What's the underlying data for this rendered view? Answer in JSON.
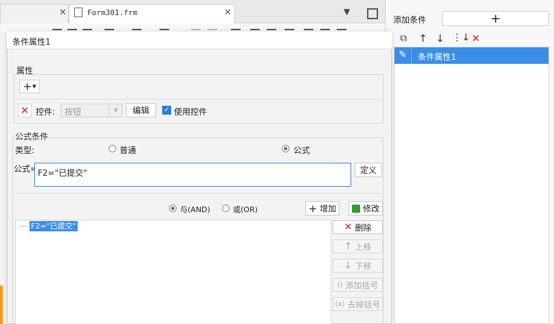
{
  "tabs": [
    {
      "label": "",
      "active": false
    },
    {
      "label": "Form301.frm",
      "active": true
    }
  ],
  "side_panel": {
    "add_condition_label": "添加条件",
    "add_symbol": "+",
    "items": [
      {
        "label": "条件属性1",
        "selected": true
      }
    ]
  },
  "dialog": {
    "title": "条件属性1",
    "attributes_section": "属性",
    "control_label": "控件:",
    "control_value": "按钮",
    "edit_button": "编辑",
    "use_control_label": "使用控件",
    "formula_section": "公式条件",
    "type_label": "类型:",
    "type_options": [
      {
        "label": "普通",
        "selected": false
      },
      {
        "label": "公式",
        "selected": true
      }
    ],
    "formula_label": "公式=",
    "formula_value": "F2=\"已提交\"",
    "define_button": "定义",
    "logic_options": [
      {
        "label": "与(AND)",
        "selected": true
      },
      {
        "label": "或(OR)",
        "selected": false
      }
    ],
    "add_button": "增加",
    "modify_button": "修改",
    "tree_item": "F2=\"已提交\"",
    "actions": {
      "delete": "删除",
      "move_up": "上移",
      "move_down": "下移",
      "add_bracket": "添加括号",
      "remove_bracket": "去掉括号"
    }
  },
  "colors": {
    "accent": "#3b82d8",
    "selection": "#3a8ee6",
    "delete_red": "#e02020",
    "orange_strip": "#f39a1e"
  }
}
